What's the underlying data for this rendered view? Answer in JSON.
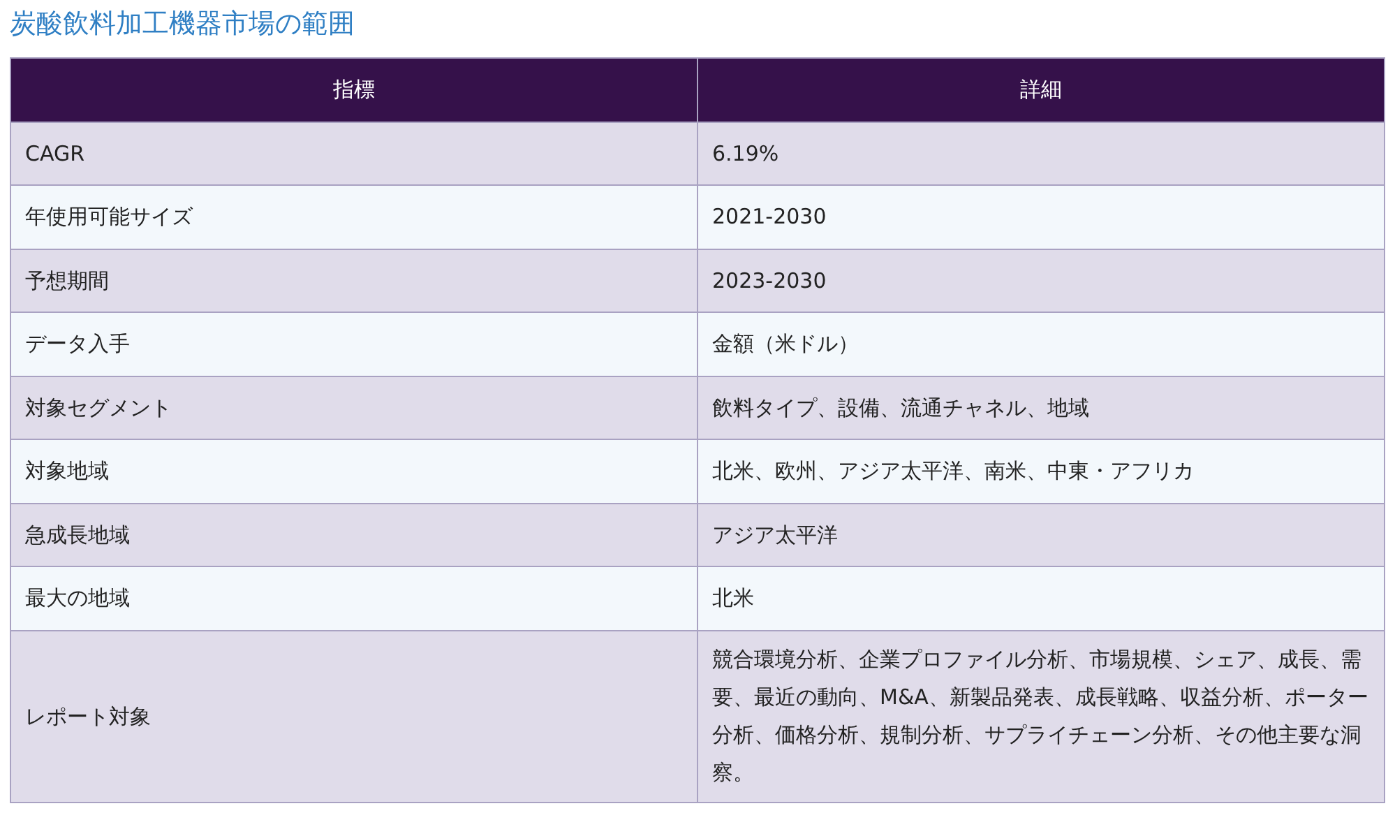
{
  "title": "炭酸飲料加工機器市場の範囲",
  "table": {
    "columns": [
      "指標",
      "詳細"
    ],
    "rows": [
      [
        "CAGR",
        "6.19%"
      ],
      [
        "年使用可能サイズ",
        "2021-2030"
      ],
      [
        "予想期間",
        "2023-2030"
      ],
      [
        "データ入手",
        "金額（米ドル）"
      ],
      [
        "対象セグメント",
        "飲料タイプ、設備、流通チャネル、地域"
      ],
      [
        "対象地域",
        "北米、欧州、アジア太平洋、南米、中東・アフリカ"
      ],
      [
        "急成長地域",
        "アジア太平洋"
      ],
      [
        "最大の地域",
        "北米"
      ],
      [
        "レポート対象",
        "競合環境分析、企業プロファイル分析、市場規模、シェア、成長、需要、最近の動向、M&A、新製品発表、成長戦略、収益分析、ポーター分析、価格分析、規制分析、サプライチェーン分析、その他主要な洞察。"
      ]
    ]
  }
}
